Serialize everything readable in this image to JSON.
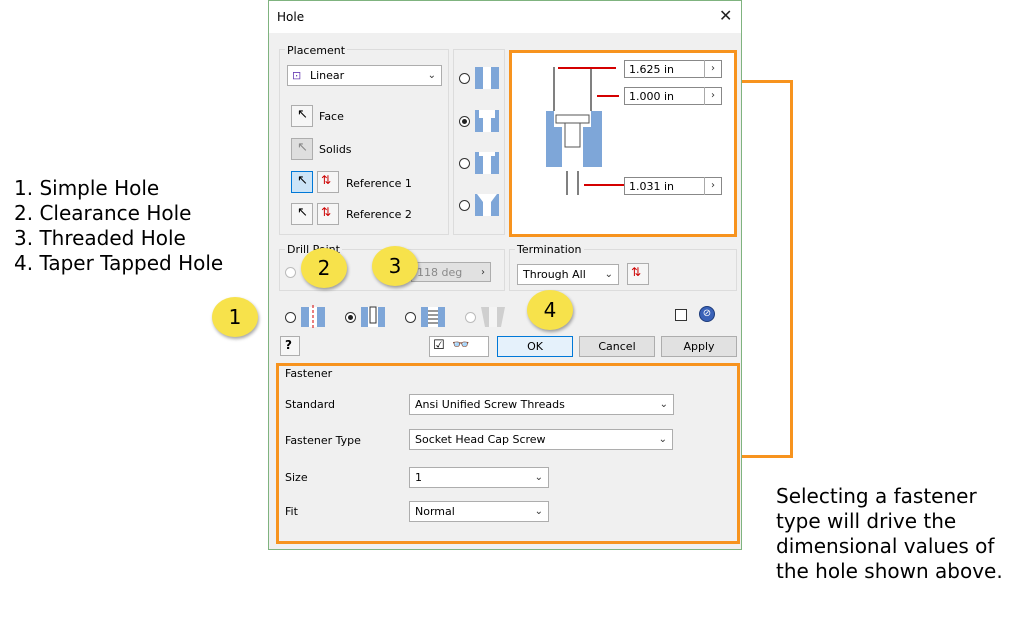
{
  "annotations": {
    "hole_types": [
      "1. Simple Hole",
      "2. Clearance Hole",
      "3. Threaded Hole",
      "4. Taper Tapped Hole"
    ],
    "note": "Selecting a fastener type will drive the dimensional values of the hole shown above.",
    "callouts": [
      "1",
      "2",
      "3",
      "4"
    ],
    "callout_color": "#f7e24b",
    "highlight_color": "#f7931e"
  },
  "dialog": {
    "title": "Hole",
    "placement": {
      "label": "Placement",
      "method": "Linear",
      "items": [
        "Face",
        "Solids",
        "Reference 1",
        "Reference 2"
      ]
    },
    "drill_point": {
      "label": "Drill Point",
      "angle": "118 deg"
    },
    "termination": {
      "label": "Termination",
      "value": "Through All"
    },
    "dimensions": [
      "1.625 in",
      "1.000 in",
      "1.031 in"
    ],
    "buttons": {
      "ok": "OK",
      "cancel": "Cancel",
      "apply": "Apply"
    },
    "fastener": {
      "label": "Fastener",
      "standard_label": "Standard",
      "standard": "Ansi Unified Screw Threads",
      "type_label": "Fastener Type",
      "type": "Socket Head Cap Screw",
      "size_label": "Size",
      "size": "1",
      "fit_label": "Fit",
      "fit": "Normal"
    }
  }
}
